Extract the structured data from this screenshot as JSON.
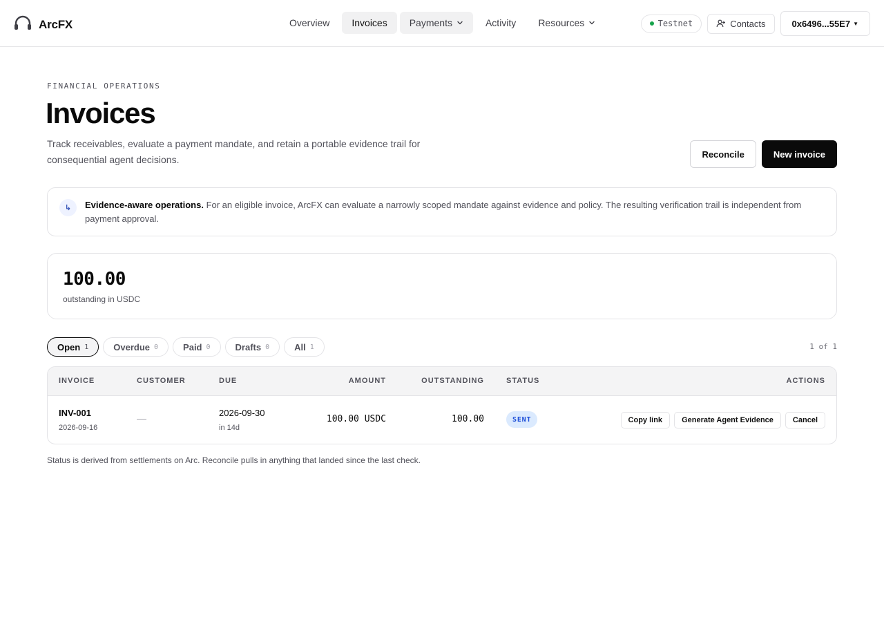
{
  "app": {
    "name": "ArcFX"
  },
  "nav": {
    "items": [
      {
        "label": "Overview"
      },
      {
        "label": "Invoices"
      },
      {
        "label": "Payments"
      },
      {
        "label": "Activity"
      },
      {
        "label": "Resources"
      }
    ],
    "active": "Invoices"
  },
  "toolbar": {
    "network": "Testnet",
    "contacts_label": "Contacts",
    "wallet_address": "0x6496...55E7"
  },
  "page": {
    "eyebrow": "FINANCIAL OPERATIONS",
    "title": "Invoices",
    "description": "Track receivables, evaluate a payment mandate, and retain a portable evidence trail for consequential agent decisions.",
    "reconcile_label": "Reconcile",
    "new_invoice_label": "New invoice"
  },
  "callout": {
    "title": "Evidence-aware operations.",
    "body": " For an eligible invoice, ArcFX can evaluate a narrowly scoped mandate against evidence and policy. The resulting verification trail is independent from payment approval."
  },
  "summary": {
    "amount": "100.00",
    "label": "outstanding in USDC"
  },
  "filters": [
    {
      "label": "Open",
      "count": "1",
      "active": true
    },
    {
      "label": "Overdue",
      "count": "0"
    },
    {
      "label": "Paid",
      "count": "0"
    },
    {
      "label": "Drafts",
      "count": "0"
    },
    {
      "label": "All",
      "count": "1"
    }
  ],
  "pager": "1 of 1",
  "table": {
    "columns": {
      "invoice": "INVOICE",
      "customer": "CUSTOMER",
      "due": "DUE",
      "amount": "AMOUNT",
      "outstanding": "OUTSTANDING",
      "status": "STATUS",
      "actions": "ACTIONS"
    },
    "rows": [
      {
        "id": "INV-001",
        "created": "2026-09-16",
        "customer": "—",
        "due": "2026-09-30",
        "due_relative": "in 14d",
        "amount": "100.00 USDC",
        "outstanding": "100.00",
        "status": "SENT",
        "actions": [
          "Copy link",
          "Generate Agent Evidence",
          "Cancel"
        ]
      }
    ]
  },
  "footnote": "Status is derived from settlements on Arc. Reconcile pulls in anything that landed since the last check.",
  "colors": {
    "accent": "#0a0a0a",
    "status_sent_bg": "#dbeafe",
    "status_sent_fg": "#1d4ed8",
    "network_dot": "#16a34a"
  }
}
